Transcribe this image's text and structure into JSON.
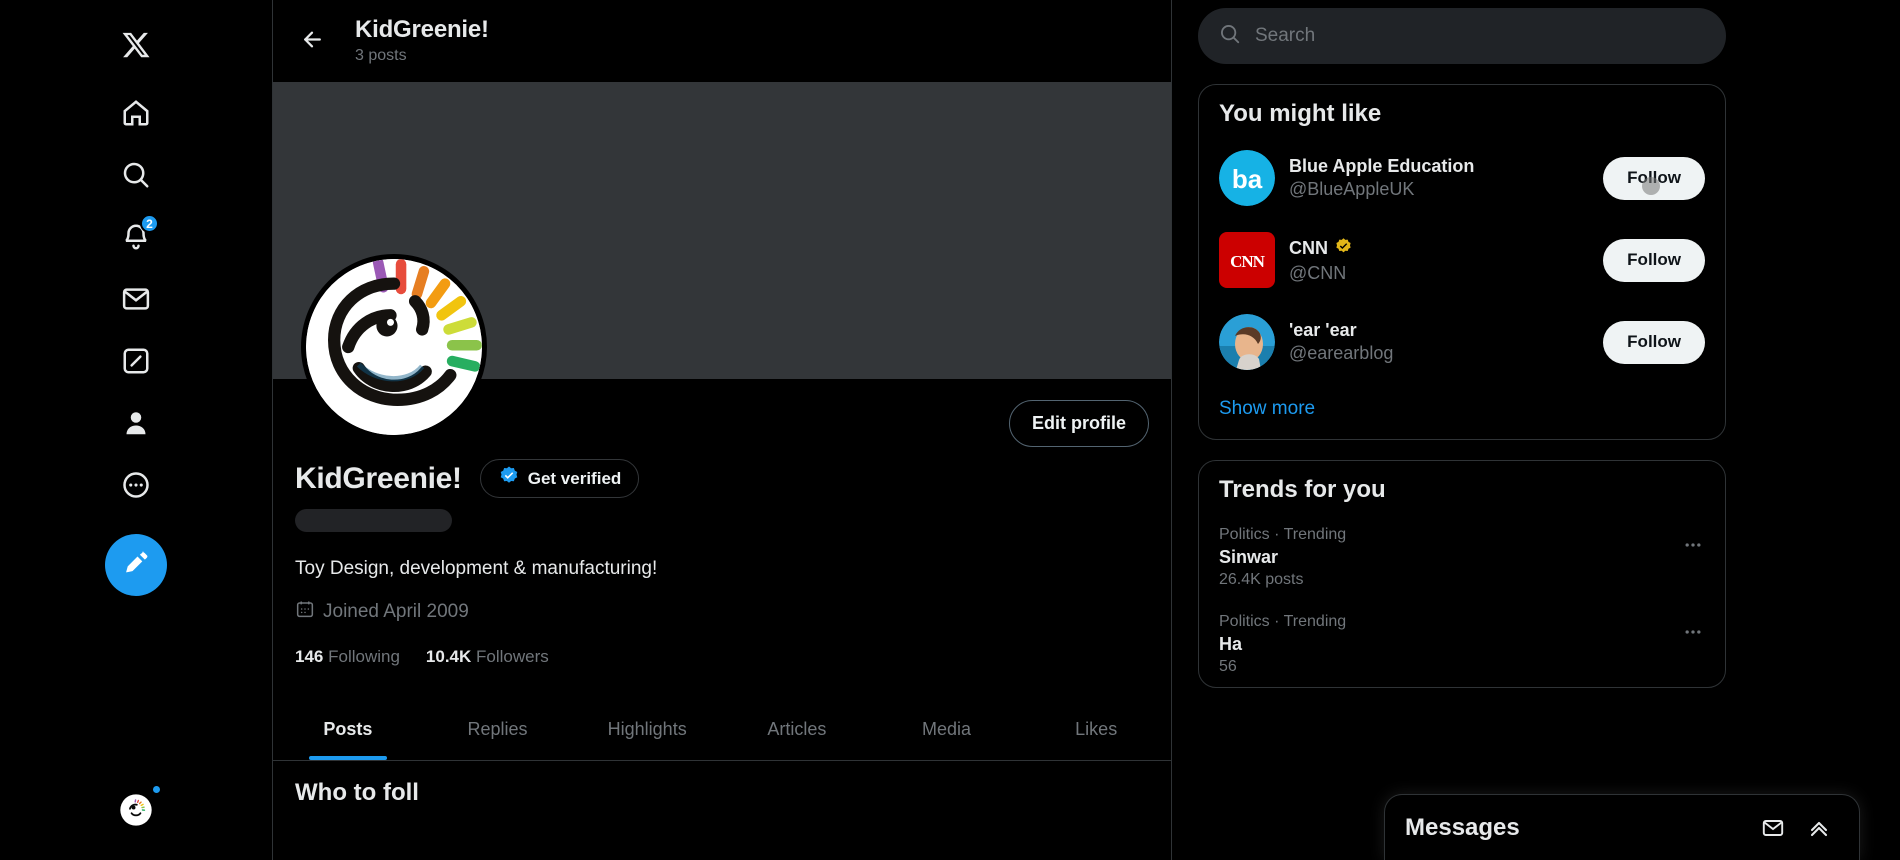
{
  "left_nav": {
    "logo": "x-logo",
    "items": [
      {
        "name": "home",
        "icon": "home-icon",
        "badge": null
      },
      {
        "name": "explore",
        "icon": "search-icon",
        "badge": null
      },
      {
        "name": "notifications",
        "icon": "bell-icon",
        "badge": "2"
      },
      {
        "name": "messages",
        "icon": "envelope-icon",
        "badge": null
      },
      {
        "name": "grok",
        "icon": "grok-icon",
        "badge": null
      },
      {
        "name": "profile",
        "icon": "person-icon",
        "badge": null
      },
      {
        "name": "more",
        "icon": "more-circle-icon",
        "badge": null
      }
    ],
    "compose_icon": "compose-post-icon",
    "account_avatar": "account-avatar"
  },
  "header": {
    "back_icon": "back-arrow-icon",
    "title": "KidGreenie!",
    "subtitle": "3 posts"
  },
  "profile": {
    "edit_button": "Edit profile",
    "display_name": "KidGreenie!",
    "get_verified_label": "Get verified",
    "verified_badge_icon": "verified-badge-icon",
    "handle_placeholder": "",
    "bio": "Toy Design, development & manufacturing!",
    "joined_icon": "calendar-icon",
    "joined": "Joined April 2009",
    "stats": [
      {
        "count": "146",
        "label": "Following"
      },
      {
        "count": "10.4K",
        "label": "Followers"
      }
    ],
    "tabs": [
      {
        "label": "Posts",
        "active": true
      },
      {
        "label": "Replies",
        "active": false
      },
      {
        "label": "Highlights",
        "active": false
      },
      {
        "label": "Articles",
        "active": false
      },
      {
        "label": "Media",
        "active": false
      },
      {
        "label": "Likes",
        "active": false
      }
    ],
    "feed_peek": "Who to foll"
  },
  "search": {
    "icon": "search-icon",
    "placeholder": "Search",
    "value": ""
  },
  "you_might_like": {
    "title": "You might like",
    "items": [
      {
        "name": "Blue Apple Education",
        "handle": "@BlueAppleUK",
        "verified": false,
        "avatar": "blue-apple-logo",
        "follow_label": "Follow"
      },
      {
        "name": "CNN",
        "handle": "@CNN",
        "verified": true,
        "avatar": "cnn-logo",
        "follow_label": "Follow"
      },
      {
        "name": "'ear 'ear",
        "handle": "@earearblog",
        "verified": false,
        "avatar": "earear-photo",
        "follow_label": "Follow"
      }
    ],
    "show_more": "Show more"
  },
  "trends": {
    "title": "Trends for you",
    "items": [
      {
        "category": "Politics · Trending",
        "name": "Sinwar",
        "count": "26.4K posts",
        "more_icon": "more-horizontal-icon"
      },
      {
        "category": "Politics · Trending",
        "name": "Ha",
        "count": "56",
        "more_icon": "more-horizontal-icon"
      }
    ]
  },
  "messages_dock": {
    "title": "Messages",
    "new_message_icon": "new-message-icon",
    "expand_icon": "chevron-up-icon"
  },
  "colors": {
    "accent": "#1d9bf0",
    "background": "#000000",
    "banner": "#333639",
    "border": "#2f3336",
    "muted_text": "#71767b",
    "text": "#e7e9ea",
    "verified_blue": "#1d9bf0",
    "verified_gold": "#e2b719"
  }
}
